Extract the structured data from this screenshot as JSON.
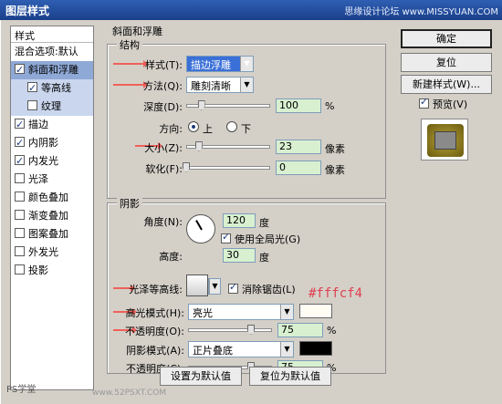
{
  "window": {
    "title": "图层样式",
    "watermark": "思缘设计论坛 www.MISSYUAN.COM"
  },
  "style_panel": {
    "header": "样式",
    "items": [
      {
        "label": "混合选项:默认",
        "checkbox": false,
        "checked": false,
        "sub": false,
        "selected": false
      },
      {
        "label": "斜面和浮雕",
        "checkbox": true,
        "checked": true,
        "sub": false,
        "selected": true
      },
      {
        "label": "等高线",
        "checkbox": true,
        "checked": true,
        "sub": true,
        "selected": false
      },
      {
        "label": "纹理",
        "checkbox": true,
        "checked": false,
        "sub": true,
        "selected": false
      },
      {
        "label": "描边",
        "checkbox": true,
        "checked": true,
        "sub": false,
        "selected": false
      },
      {
        "label": "内阴影",
        "checkbox": true,
        "checked": true,
        "sub": false,
        "selected": false
      },
      {
        "label": "内发光",
        "checkbox": true,
        "checked": true,
        "sub": false,
        "selected": false
      },
      {
        "label": "光泽",
        "checkbox": true,
        "checked": false,
        "sub": false,
        "selected": false
      },
      {
        "label": "颜色叠加",
        "checkbox": true,
        "checked": false,
        "sub": false,
        "selected": false
      },
      {
        "label": "渐变叠加",
        "checkbox": true,
        "checked": false,
        "sub": false,
        "selected": false
      },
      {
        "label": "图案叠加",
        "checkbox": true,
        "checked": false,
        "sub": false,
        "selected": false
      },
      {
        "label": "外发光",
        "checkbox": true,
        "checked": false,
        "sub": false,
        "selected": false
      },
      {
        "label": "投影",
        "checkbox": true,
        "checked": false,
        "sub": false,
        "selected": false
      }
    ]
  },
  "section_title": "斜面和浮雕",
  "structure": {
    "legend": "结构",
    "style_label": "样式(T):",
    "style_value": "描边浮雕",
    "technique_label": "方法(Q):",
    "technique_value": "雕刻清晰",
    "depth_label": "深度(D):",
    "depth_value": "100",
    "depth_unit": "%",
    "direction_label": "方向:",
    "direction_up": "上",
    "direction_down": "下",
    "size_label": "大小(Z):",
    "size_value": "23",
    "size_unit": "像素",
    "soften_label": "软化(F):",
    "soften_value": "0",
    "soften_unit": "像素"
  },
  "shading": {
    "legend": "阴影",
    "angle_label": "角度(N):",
    "angle_value": "120",
    "angle_unit": "度",
    "global_light_label": "使用全局光(G)",
    "altitude_label": "高度:",
    "altitude_value": "30",
    "altitude_unit": "度",
    "gloss_contour_label": "光泽等高线:",
    "antialias_label": "消除锯齿(L)",
    "highlight_mode_label": "高光模式(H):",
    "highlight_mode_value": "亮光",
    "highlight_opacity_label": "不透明度(O):",
    "highlight_opacity_value": "75",
    "shadow_mode_label": "阴影模式(A):",
    "shadow_mode_value": "正片叠底",
    "shadow_opacity_label": "不透明度(C):",
    "shadow_opacity_value": "75",
    "percent": "%"
  },
  "annotation_hex": "#fffcf4",
  "colors": {
    "highlight_swatch": "#fffcf4",
    "shadow_swatch": "#000000",
    "annotation_arrow": "#f0605a"
  },
  "buttons": {
    "ok": "确定",
    "reset": "复位",
    "new_style": "新建样式(W)...",
    "preview": "预览(V)",
    "make_default": "设置为默认值",
    "reset_default": "复位为默认值"
  },
  "slider_levels": {
    "depth": 0.18,
    "size": 0.15,
    "soften": 0.0,
    "highlight_opacity": 0.75,
    "shadow_opacity": 0.75
  },
  "footer_watermark": "PS学堂",
  "footer_site": "www.52PSXT.COM"
}
